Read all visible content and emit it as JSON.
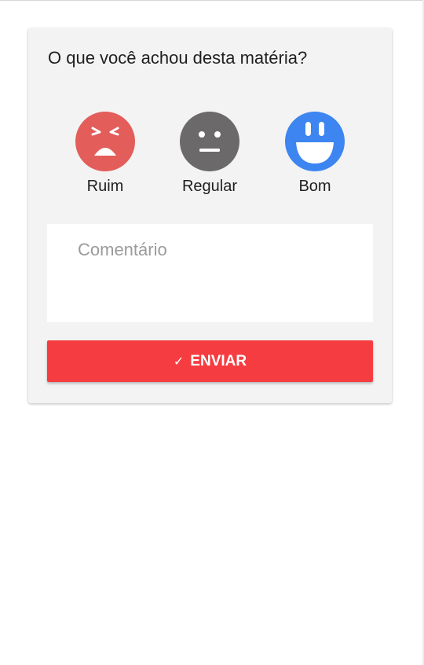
{
  "survey": {
    "question": "O que você achou desta matéria?",
    "ratings": [
      {
        "label": "Ruim",
        "icon": "angry-face-icon",
        "color": "#e35d5b"
      },
      {
        "label": "Regular",
        "icon": "neutral-face-icon",
        "color": "#6b6969"
      },
      {
        "label": "Bom",
        "icon": "happy-face-icon",
        "color": "#3d85f0"
      }
    ],
    "comment": {
      "placeholder": "Comentário",
      "value": ""
    },
    "submit": {
      "icon": "check-icon",
      "check_glyph": "✓",
      "label": "ENVIAR",
      "color": "#f53d41"
    }
  }
}
